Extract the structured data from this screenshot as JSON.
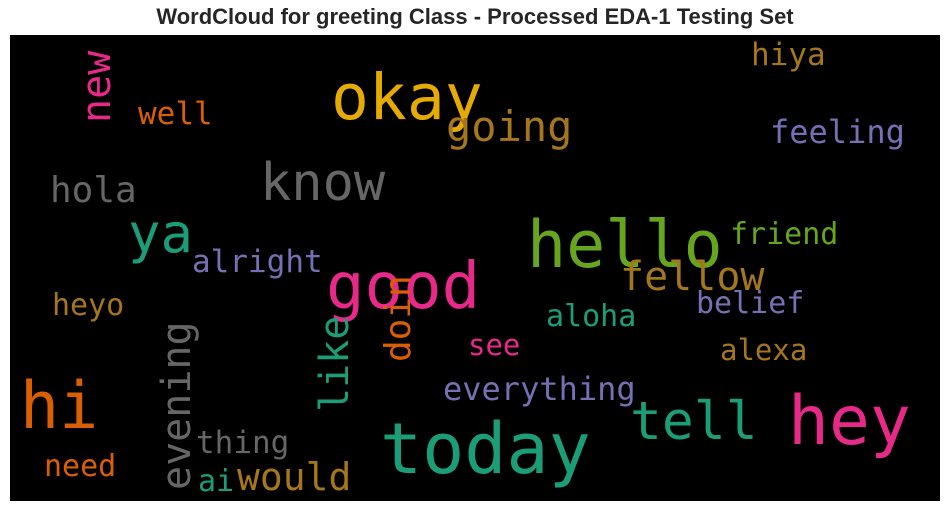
{
  "chart_data": {
    "type": "wordcloud",
    "title": "WordCloud for greeting Class - Processed EDA-1 Testing Set",
    "background": "#000000",
    "colormap": "Dark2",
    "words": [
      {
        "text": "hey",
        "color": "#e7298a"
      },
      {
        "text": "today",
        "color": "#1b9e77"
      },
      {
        "text": "hello",
        "color": "#66a61e"
      },
      {
        "text": "good",
        "color": "#e7298a"
      },
      {
        "text": "okay",
        "color": "#e6ab02"
      },
      {
        "text": "hi",
        "color": "#d95f02"
      },
      {
        "text": "know",
        "color": "#666666"
      },
      {
        "text": "ya",
        "color": "#1b9e77"
      },
      {
        "text": "tell",
        "color": "#1b9e77"
      },
      {
        "text": "going",
        "color": "#a6761d"
      },
      {
        "text": "fellow",
        "color": "#a6761d"
      },
      {
        "text": "new",
        "color": "#e7298a"
      },
      {
        "text": "evening",
        "color": "#666666"
      },
      {
        "text": "like",
        "color": "#1b9e77"
      },
      {
        "text": "would",
        "color": "#a6761d"
      },
      {
        "text": "doin",
        "color": "#d95f02"
      },
      {
        "text": "everything",
        "color": "#7570b3"
      },
      {
        "text": "hola",
        "color": "#666666"
      },
      {
        "text": "feeling",
        "color": "#7570b3"
      },
      {
        "text": "alright",
        "color": "#7570b3"
      },
      {
        "text": "belief",
        "color": "#7570b3"
      },
      {
        "text": "friend",
        "color": "#66a61e"
      },
      {
        "text": "thing",
        "color": "#666666"
      },
      {
        "text": "well",
        "color": "#d95f02"
      },
      {
        "text": "hiya",
        "color": "#a6761d"
      },
      {
        "text": "aloha",
        "color": "#1b9e77"
      },
      {
        "text": "alexa",
        "color": "#a6761d"
      },
      {
        "text": "heyo",
        "color": "#a6761d"
      },
      {
        "text": "need",
        "color": "#d95f02"
      },
      {
        "text": "see",
        "color": "#e7298a"
      },
      {
        "text": "ai",
        "color": "#1b9e77"
      }
    ]
  }
}
